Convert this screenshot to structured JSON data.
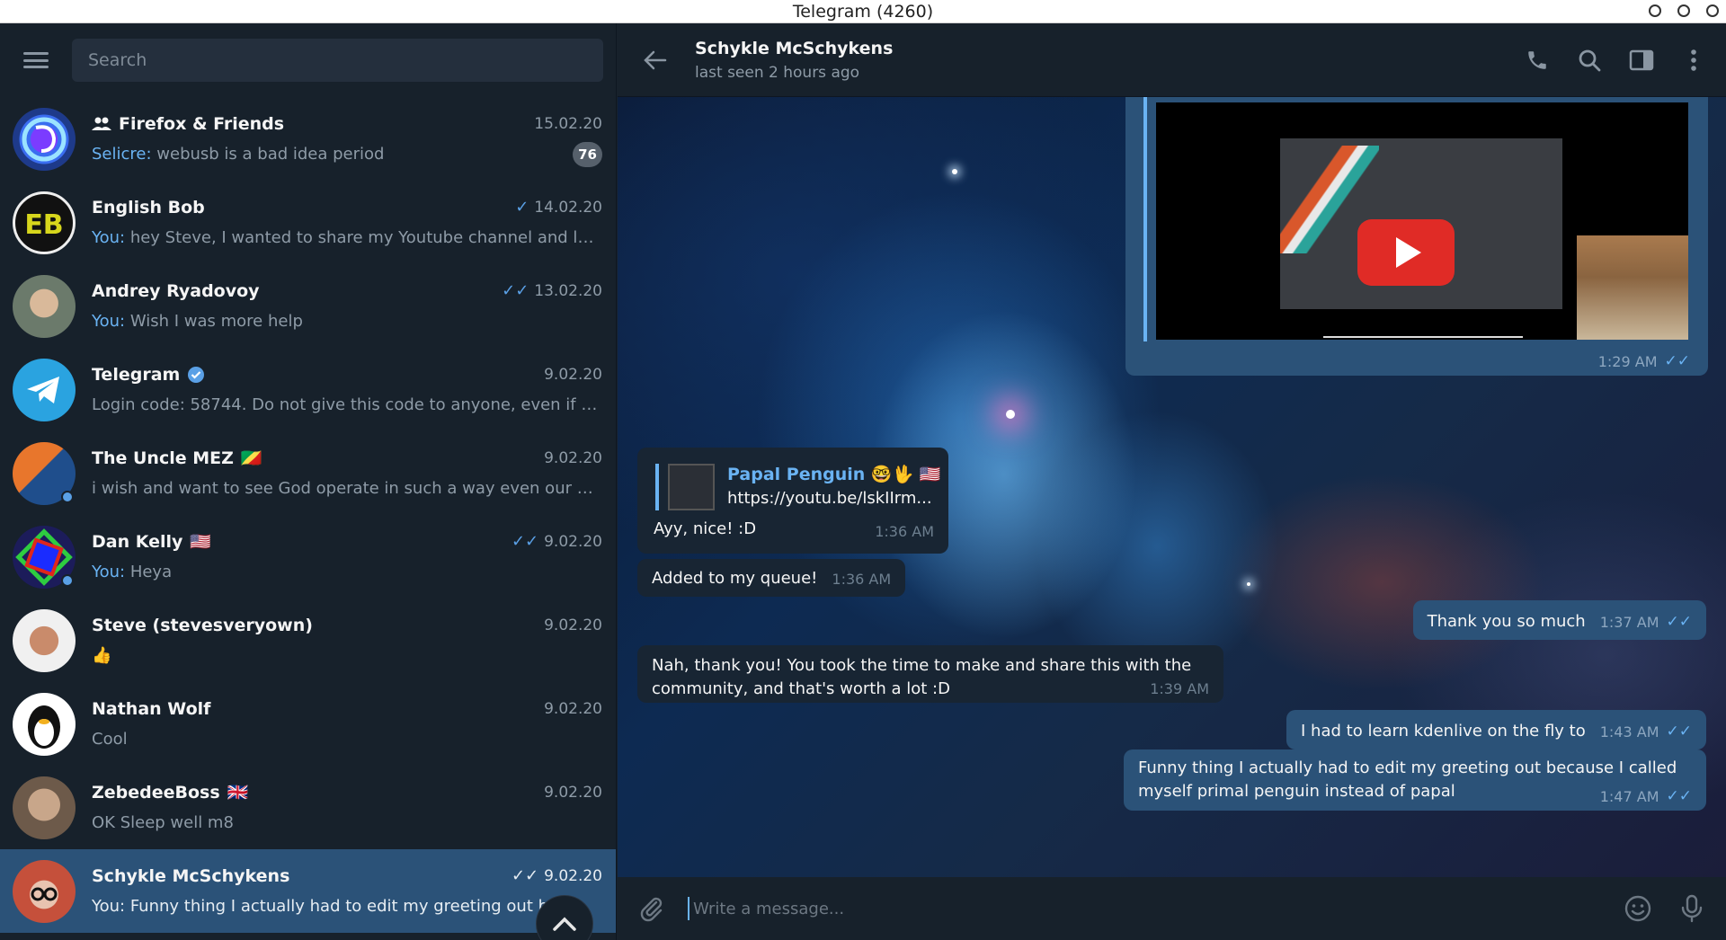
{
  "window": {
    "title": "Telegram (4260)"
  },
  "sidebar": {
    "search_placeholder": "Search",
    "chats": [
      {
        "name": "Firefox & Friends",
        "date": "15.02.20",
        "sender": "Selicre:",
        "preview": " webusb is a bad idea period",
        "badge": "76",
        "is_group": true
      },
      {
        "name": "English Bob",
        "date": "14.02.20",
        "sender": "You:",
        "preview": " hey Steve, I wanted to share my Youtube channel and lat...",
        "status": "read-single"
      },
      {
        "name": "Andrey Ryadovoy",
        "date": "13.02.20",
        "sender": "You:",
        "preview": " Wish I was more help",
        "status": "read-double"
      },
      {
        "name": "Telegram",
        "date": "9.02.20",
        "sender": "",
        "preview": "Login code: 58744. Do not give this code to anyone, even if the...",
        "verified": true
      },
      {
        "name": "The Uncle MEZ",
        "date": "9.02.20",
        "sender": "",
        "preview": "i wish and want to see God operate in such a way even our dis...",
        "flag": "🇨🇬"
      },
      {
        "name": "Dan Kelly",
        "date": "9.02.20",
        "sender": "You:",
        "preview": " Heya",
        "flag": "🇺🇸",
        "status": "read-double"
      },
      {
        "name": "Steve (stevesveryown)",
        "date": "9.02.20",
        "sender": "",
        "preview": "👍"
      },
      {
        "name": "Nathan Wolf",
        "date": "9.02.20",
        "sender": "",
        "preview": "Cool"
      },
      {
        "name": "ZebedeeBoss",
        "date": "9.02.20",
        "sender": "",
        "preview": "OK Sleep well m8",
        "flag": "🇬🇧"
      },
      {
        "name": "Schykle McSchykens",
        "date": "9.02.20",
        "sender": "You:",
        "preview": " Funny thing I actually had to edit my greeting out be...",
        "status": "read-double",
        "active": true
      }
    ]
  },
  "header": {
    "name": "Schykle McSchykens",
    "status": "last seen 2 hours ago"
  },
  "messages": {
    "video": {
      "time": "1:29 AM"
    },
    "reply": {
      "reply_name": "Papal Penguin 🤓🖖 🇺🇸",
      "reply_link": "https://youtu.be/lskIIrm...",
      "text": "Ayy, nice! :D",
      "time": "1:36 AM"
    },
    "queue": {
      "text": "Added to my queue!",
      "time": "1:36 AM"
    },
    "thanks": {
      "text": "Thank you so much",
      "time": "1:37 AM"
    },
    "nah": {
      "text": "Nah, thank you! You took the time to make and share this with the community, and that's worth a lot :D",
      "time": "1:39 AM"
    },
    "kden": {
      "text": "I had to learn kdenlive on the fly to",
      "time": "1:43 AM"
    },
    "funny": {
      "text": "Funny thing I actually had to edit my greeting out because I called myself primal penguin instead of papal",
      "time": "1:47 AM"
    }
  },
  "composer": {
    "placeholder": "Write a message..."
  },
  "colors": {
    "sidebar_bg": "#17212b",
    "active_chat": "#2b5278",
    "accent": "#6ab3f3",
    "incoming_bubble": "#182533",
    "outgoing_bubble": "#2b5278"
  }
}
